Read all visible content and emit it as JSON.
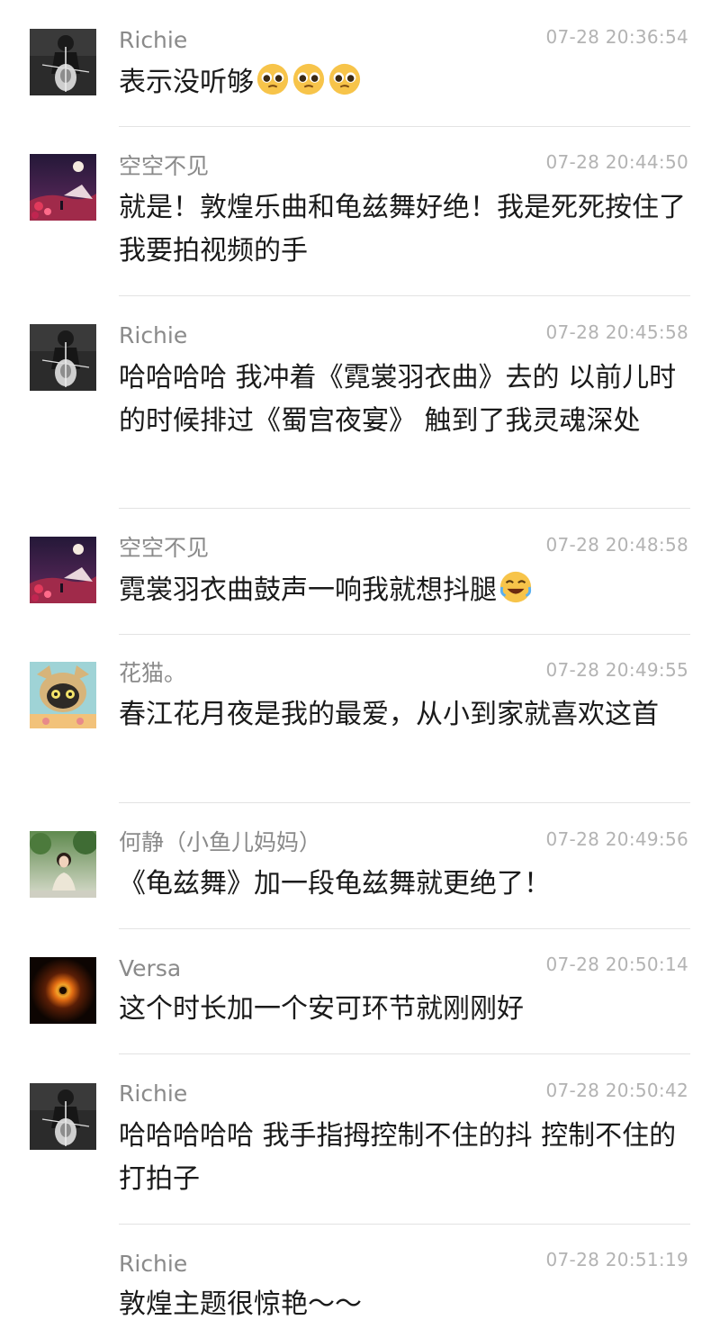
{
  "comments": [
    {
      "name": "Richie",
      "time": "07-28 20:36:54",
      "text": "表示没听够",
      "emoji": "pleading-face-icon ×3"
    },
    {
      "name": "空空不见",
      "time": "07-28 20:44:50",
      "text": "就是！敦煌乐曲和龟兹舞好绝！我是死死按住了我要拍视频的手"
    },
    {
      "name": "Richie",
      "time": "07-28 20:45:58",
      "text": "哈哈哈哈 我冲着《霓裳羽衣曲》去的 以前儿时的时候排过《蜀宫夜宴》 触到了我灵魂深处"
    },
    {
      "name": "空空不见",
      "time": "07-28 20:48:58",
      "text": "霓裳羽衣曲鼓声一响我就想抖腿",
      "emoji": "rolling-laughing-icon"
    },
    {
      "name": "花猫。",
      "time": "07-28 20:49:55",
      "text": "春江花月夜是我的最爱，从小到家就喜欢这首"
    },
    {
      "name": "何静（小鱼儿妈妈）",
      "time": "07-28 20:49:56",
      "text": "《龟兹舞》加一段龟兹舞就更绝了！"
    },
    {
      "name": "Versa",
      "time": "07-28 20:50:14",
      "text": "这个时长加一个安可环节就刚刚好"
    },
    {
      "name": "Richie",
      "time": "07-28 20:50:42",
      "text": "哈哈哈哈哈 我手指拇控制不住的抖 控制不住的打拍子"
    },
    {
      "name": "Richie",
      "time": "07-28 20:51:19",
      "text": "敦煌主题很惊艳～～"
    }
  ],
  "colors": {
    "name": "#8a8a8a",
    "time": "#b3b3b3",
    "text": "#1a1a1a",
    "divider": "#e3e3e3"
  }
}
